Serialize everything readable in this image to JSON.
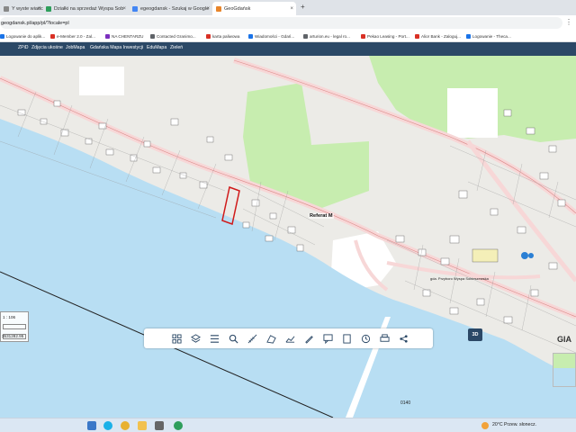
{
  "browser": {
    "tabs": [
      {
        "title": "Y wyste wiadc",
        "color": "#888888"
      },
      {
        "title": "Działki na sprzedaż Wyspa Sob",
        "color": "#2e9e5b"
      },
      {
        "title": "egeogdansk - Szukaj w Google",
        "color": "#4285f4"
      },
      {
        "title": "GeoGdańsk",
        "color": "#e8852b"
      }
    ],
    "new_tab": "+",
    "close": "×",
    "url": "geogdansk.pl/app/pl/?locale=pl",
    "menu": "⋮"
  },
  "bookmarks": [
    {
      "label": "Logowanie do aplik...",
      "color": "#1a73e8"
    },
    {
      "label": "e-Member 2.0 - Zal...",
      "color": "#d93025"
    },
    {
      "label": "NA CHENTARZU",
      "color": "#7b2fbe"
    },
    {
      "label": "Contacted Granimo...",
      "color": "#5f6368"
    },
    {
      "label": "karta paliwowa",
      "color": "#d93025"
    },
    {
      "label": "Wiadomości - Gdań...",
      "color": "#1a73e8"
    },
    {
      "label": "arturion.eu - legal ro...",
      "color": "#5f6368"
    },
    {
      "label": "Pekao Leasing - Port...",
      "color": "#d93025"
    },
    {
      "label": "Alior Bank - Zaloguj...",
      "color": "#d93025"
    },
    {
      "label": "Logowanie - Theca...",
      "color": "#1a73e8"
    }
  ],
  "app_menu": [
    "ZPiD",
    "Zdjęcia ukośne",
    "JobMapa",
    "Gdańska Mapa Inwestycji",
    "EduMapa",
    "Zieleń"
  ],
  "map": {
    "reference_label": "Referat M",
    "street_labels": [
      "gda. Przyboro Wyspa Sobieszewska",
      "0140"
    ],
    "scale_ratio": "1 : 106",
    "coord_text": "3531282.95",
    "gia_label": "GIA",
    "btn_3d": "3D"
  },
  "toolbar_icons": [
    "grid-icon",
    "layers-icon",
    "list-icon",
    "search-icon",
    "measure-icon",
    "area-icon",
    "profile-icon",
    "draw-icon",
    "annotate-icon",
    "print-area-icon",
    "history-icon",
    "print-icon",
    "share-icon"
  ],
  "taskbar": {
    "weather": "20°C  Przew. słonecz."
  },
  "colors": {
    "header": "#2b4866",
    "water": "#b8def3",
    "green": "#c7edaf",
    "parcel_selected": "#d01a1a"
  }
}
